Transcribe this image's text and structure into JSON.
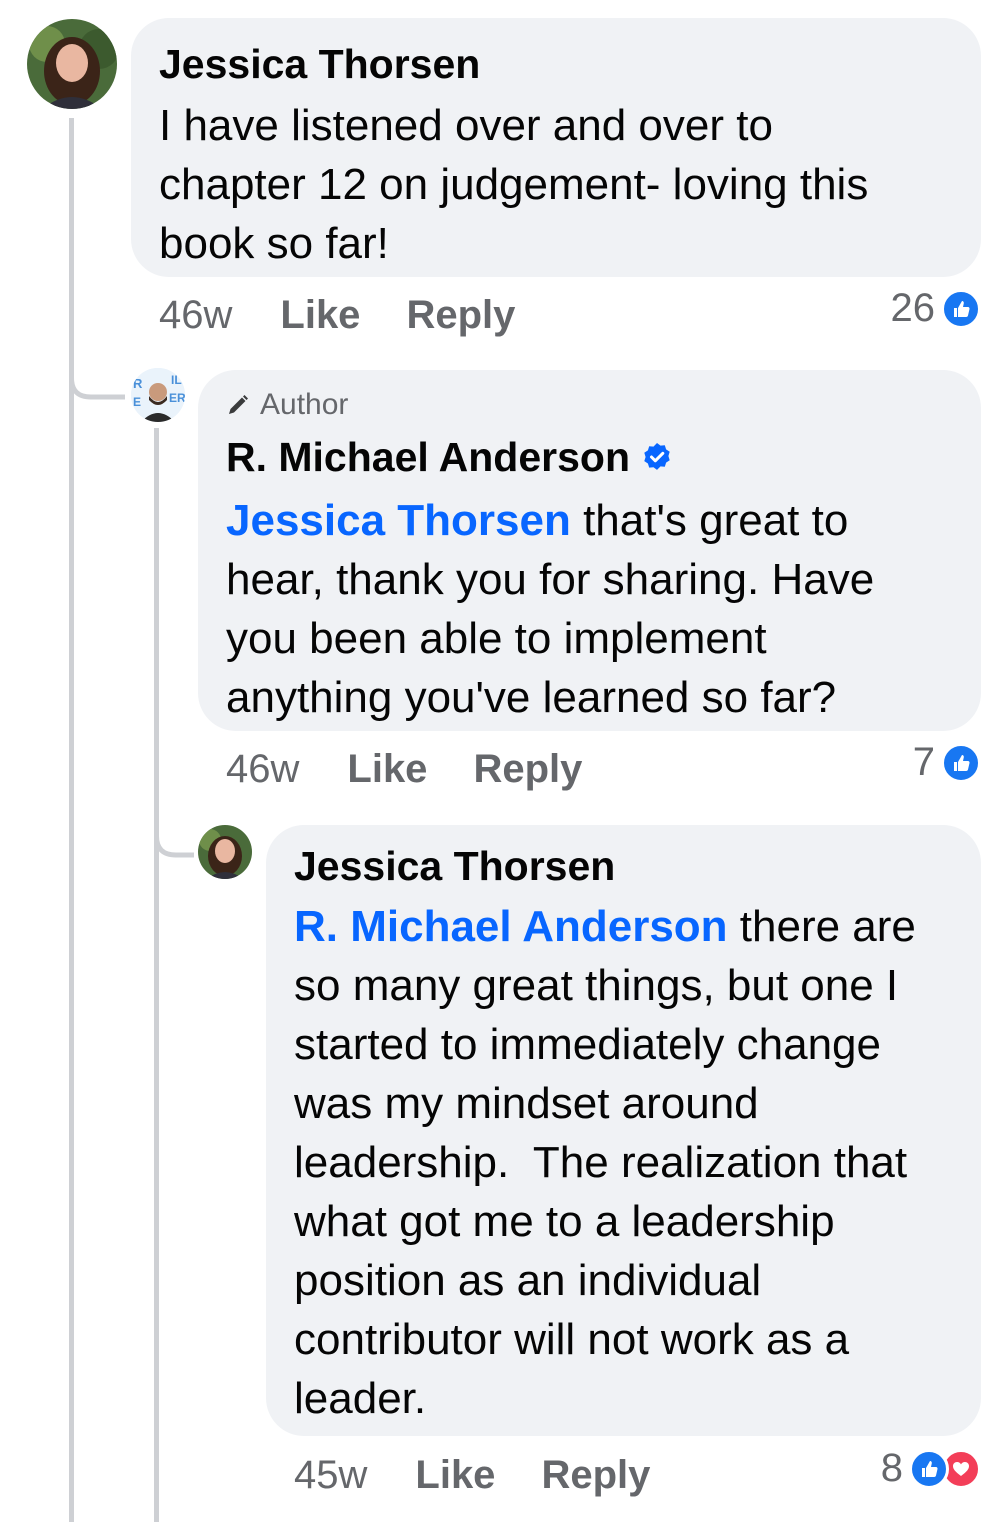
{
  "colors": {
    "bubble": "#f0f2f5",
    "mention": "#0866ff",
    "meta": "#65676b",
    "like": "#1877f2",
    "love": "#f33e58",
    "thread_line": "#ced0d4"
  },
  "comments": [
    {
      "author": "Jessica Thorsen",
      "text_lines": [
        "I have listened over and over to",
        "chapter 12 on judgement- loving this",
        "book so far!"
      ],
      "time": "46w",
      "like_label": "Like",
      "reply_label": "Reply",
      "reaction_count": "26",
      "reactions": [
        "like-icon"
      ]
    },
    {
      "badge": "Author",
      "author": "R. Michael Anderson",
      "mention": "Jessica Thorsen",
      "first_line_rest": " that's great to",
      "text_lines": [
        "hear, thank you for sharing. Have",
        "you been able to implement",
        "anything you've learned so far?"
      ],
      "time": "46w",
      "like_label": "Like",
      "reply_label": "Reply",
      "reaction_count": "7",
      "reactions": [
        "like-icon"
      ]
    },
    {
      "author": "Jessica Thorsen",
      "mention": "R. Michael Anderson",
      "first_line_rest": " there are",
      "text_lines": [
        "so many great things, but one I",
        "started to immediately change",
        "was my mindset around",
        "leadership.  The realization that",
        "what got me to a leadership",
        "position as an individual",
        "contributor will not work as a",
        "leader."
      ],
      "time": "45w",
      "like_label": "Like",
      "reply_label": "Reply",
      "reaction_count": "8",
      "reactions": [
        "like-icon",
        "love-icon"
      ]
    }
  ]
}
